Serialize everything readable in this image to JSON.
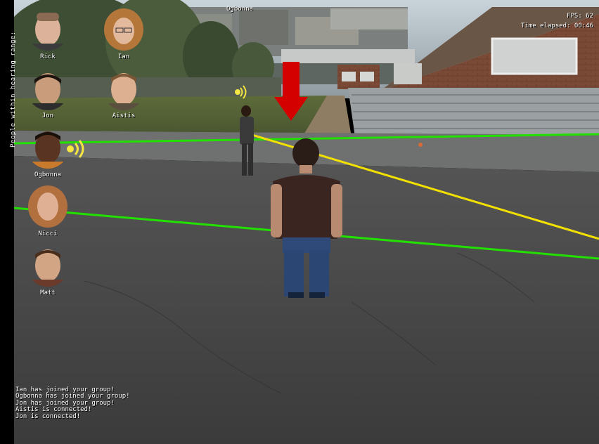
{
  "hud": {
    "fps": "FPS: 62",
    "time_elapsed": "Time elapsed: 00:46",
    "target_name": "Ogbonna",
    "side_label": "People within hearing range:"
  },
  "participants": [
    {
      "name": "Rick",
      "speaking": false
    },
    {
      "name": "Ian",
      "speaking": false
    },
    {
      "name": "Jon",
      "speaking": false
    },
    {
      "name": "Aistis",
      "speaking": false
    },
    {
      "name": "Ogbonna",
      "speaking": true
    },
    {
      "name": "Nicci",
      "speaking": false
    },
    {
      "name": "Matt",
      "speaking": false
    }
  ],
  "log": [
    "Ian has joined your group!",
    "Ogbonna has joined your group!",
    "Jon has joined your group!",
    "Aistis is connected!",
    "Jon is connected!"
  ],
  "colors": {
    "range_line": "#22e000",
    "sightline": "#f2e000",
    "marker": "#d40000",
    "speaking_icon": "#f5e642"
  }
}
